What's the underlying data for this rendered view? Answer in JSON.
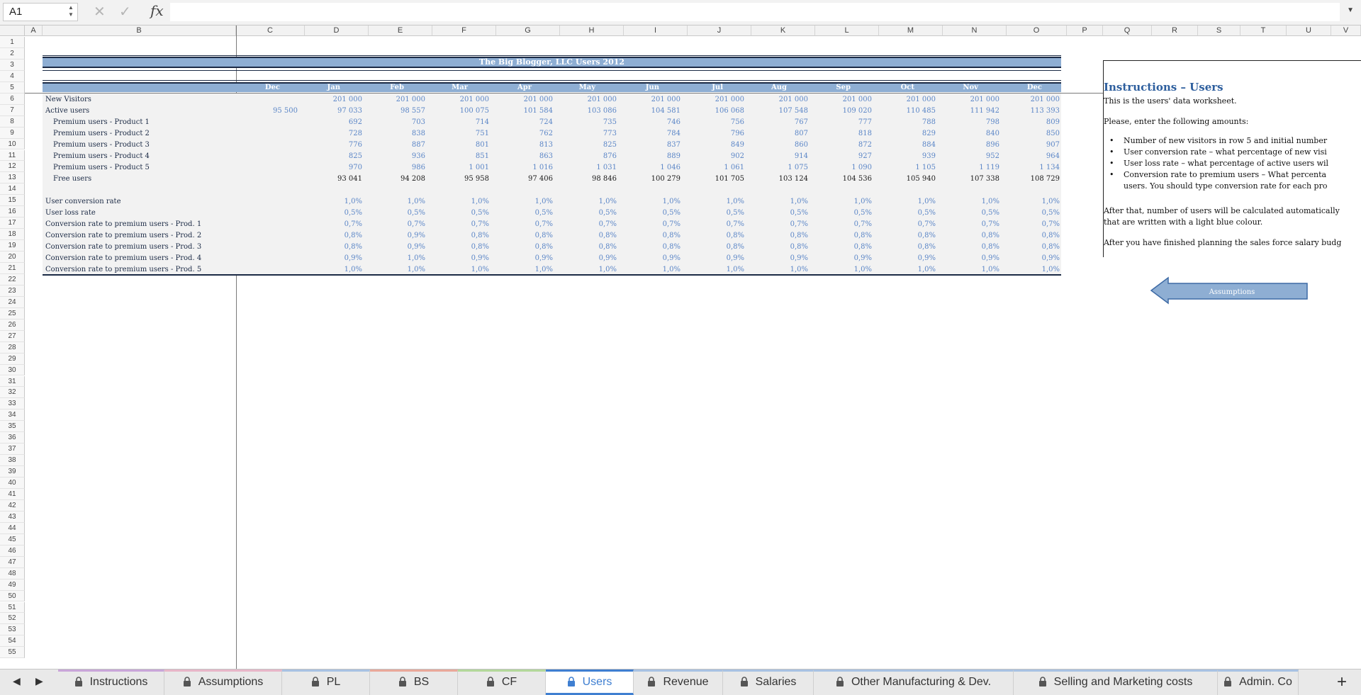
{
  "formula_bar": {
    "cell_ref": "A1",
    "formula": "",
    "fx_label": "fx"
  },
  "columns": [
    "A",
    "B",
    "C",
    "D",
    "E",
    "F",
    "G",
    "H",
    "I",
    "J",
    "K",
    "L",
    "M",
    "N",
    "O",
    "P",
    "Q",
    "R",
    "S",
    "T",
    "U",
    "V"
  ],
  "rows": [
    "1",
    "2",
    "3",
    "4",
    "5",
    "6",
    "7",
    "8",
    "9",
    "10",
    "11",
    "12",
    "13",
    "14",
    "15",
    "16",
    "17",
    "18",
    "19",
    "20",
    "21",
    "22",
    "23",
    "24",
    "25",
    "26",
    "27",
    "28",
    "29",
    "30",
    "31",
    "32",
    "33",
    "34",
    "35",
    "36",
    "37",
    "38",
    "39",
    "40",
    "41",
    "42",
    "43",
    "44",
    "45",
    "46",
    "47",
    "48",
    "49",
    "50",
    "51",
    "52",
    "53",
    "54",
    "55"
  ],
  "sheet": {
    "title": "The Big Blogger, LLC Users 2012",
    "months": [
      "Dec",
      "Jan",
      "Feb",
      "Mar",
      "Apr",
      "May",
      "Jun",
      "Jul",
      "Aug",
      "Sep",
      "Oct",
      "Nov",
      "Dec"
    ],
    "table": [
      {
        "label": "New Visitors",
        "indent": false,
        "values": [
          "",
          "201 000",
          "201 000",
          "201 000",
          "201 000",
          "201 000",
          "201 000",
          "201 000",
          "201 000",
          "201 000",
          "201 000",
          "201 000",
          "201 000"
        ],
        "style": "input"
      },
      {
        "label": "Active users",
        "indent": false,
        "values": [
          "95 500",
          "97 033",
          "98 557",
          "100 075",
          "101 584",
          "103 086",
          "104 581",
          "106 068",
          "107 548",
          "109 020",
          "110 485",
          "111 942",
          "113 393"
        ],
        "style": "input"
      },
      {
        "label": "Premium users - Product 1",
        "indent": true,
        "values": [
          "",
          "692",
          "703",
          "714",
          "724",
          "735",
          "746",
          "756",
          "767",
          "777",
          "788",
          "798",
          "809"
        ],
        "style": "input"
      },
      {
        "label": "Premium users - Product 2",
        "indent": true,
        "values": [
          "",
          "728",
          "838",
          "751",
          "762",
          "773",
          "784",
          "796",
          "807",
          "818",
          "829",
          "840",
          "850"
        ],
        "style": "input"
      },
      {
        "label": "Premium users - Product 3",
        "indent": true,
        "values": [
          "",
          "776",
          "887",
          "801",
          "813",
          "825",
          "837",
          "849",
          "860",
          "872",
          "884",
          "896",
          "907"
        ],
        "style": "input"
      },
      {
        "label": "Premium users - Product 4",
        "indent": true,
        "values": [
          "",
          "825",
          "936",
          "851",
          "863",
          "876",
          "889",
          "902",
          "914",
          "927",
          "939",
          "952",
          "964"
        ],
        "style": "input"
      },
      {
        "label": "Premium users - Product 5",
        "indent": true,
        "values": [
          "",
          "970",
          "986",
          "1 001",
          "1 016",
          "1 031",
          "1 046",
          "1 061",
          "1 075",
          "1 090",
          "1 105",
          "1 119",
          "1 134"
        ],
        "style": "input"
      },
      {
        "label": "Free users",
        "indent": true,
        "values": [
          "",
          "93 041",
          "94 208",
          "95 958",
          "97 406",
          "98 846",
          "100 279",
          "101 705",
          "103 124",
          "104 536",
          "105 940",
          "107 338",
          "108 729"
        ],
        "style": "calc"
      },
      {
        "label": "",
        "indent": false,
        "values": [
          "",
          "",
          "",
          "",
          "",
          "",
          "",
          "",
          "",
          "",
          "",
          "",
          ""
        ],
        "style": "input"
      },
      {
        "label": "User conversion rate",
        "indent": false,
        "values": [
          "",
          "1,0%",
          "1,0%",
          "1,0%",
          "1,0%",
          "1,0%",
          "1,0%",
          "1,0%",
          "1,0%",
          "1,0%",
          "1,0%",
          "1,0%",
          "1,0%"
        ],
        "style": "input"
      },
      {
        "label": "User loss rate",
        "indent": false,
        "values": [
          "",
          "0,5%",
          "0,5%",
          "0,5%",
          "0,5%",
          "0,5%",
          "0,5%",
          "0,5%",
          "0,5%",
          "0,5%",
          "0,5%",
          "0,5%",
          "0,5%"
        ],
        "style": "input"
      },
      {
        "label": "Conversion rate to premium users - Prod. 1",
        "indent": false,
        "values": [
          "",
          "0,7%",
          "0,7%",
          "0,7%",
          "0,7%",
          "0,7%",
          "0,7%",
          "0,7%",
          "0,7%",
          "0,7%",
          "0,7%",
          "0,7%",
          "0,7%"
        ],
        "style": "input"
      },
      {
        "label": "Conversion rate to premium users - Prod. 2",
        "indent": false,
        "values": [
          "",
          "0,8%",
          "0,9%",
          "0,8%",
          "0,8%",
          "0,8%",
          "0,8%",
          "0,8%",
          "0,8%",
          "0,8%",
          "0,8%",
          "0,8%",
          "0,8%"
        ],
        "style": "input"
      },
      {
        "label": "Conversion rate to premium users - Prod. 3",
        "indent": false,
        "values": [
          "",
          "0,8%",
          "0,9%",
          "0,8%",
          "0,8%",
          "0,8%",
          "0,8%",
          "0,8%",
          "0,8%",
          "0,8%",
          "0,8%",
          "0,8%",
          "0,8%"
        ],
        "style": "input"
      },
      {
        "label": "Conversion rate to premium users - Prod. 4",
        "indent": false,
        "values": [
          "",
          "0,9%",
          "1,0%",
          "0,9%",
          "0,9%",
          "0,9%",
          "0,9%",
          "0,9%",
          "0,9%",
          "0,9%",
          "0,9%",
          "0,9%",
          "0,9%"
        ],
        "style": "input"
      },
      {
        "label": "Conversion rate to premium users - Prod. 5",
        "indent": false,
        "values": [
          "",
          "1,0%",
          "1,0%",
          "1,0%",
          "1,0%",
          "1,0%",
          "1,0%",
          "1,0%",
          "1,0%",
          "1,0%",
          "1,0%",
          "1,0%",
          "1,0%"
        ],
        "style": "input"
      }
    ]
  },
  "instructions": {
    "heading": "Instructions – Users",
    "intro": "This is the users' data worksheet.",
    "please": "Please, enter the following amounts:",
    "bullets": [
      "Number of new visitors in row 5 and initial number",
      "User conversion rate – what percentage of new visi",
      "User loss rate – what percentage of active users wil",
      "Conversion rate to premium users – What percenta",
      "users. You should type conversion rate for each pro"
    ],
    "after1": "After that, number of users will be calculated automatically",
    "after2": "that are written with a light blue colour.",
    "after3": "After you have finished planning the sales force salary budg"
  },
  "nav_button": {
    "label": "Assumptions"
  },
  "tabs": [
    {
      "label": "Instructions",
      "locked": true,
      "active": false,
      "accent": "#c9a6d9"
    },
    {
      "label": "Assumptions",
      "locked": true,
      "active": false,
      "accent": "#e7b6c8"
    },
    {
      "label": "PL",
      "locked": true,
      "active": false,
      "accent": "#a8c2e3"
    },
    {
      "label": "BS",
      "locked": true,
      "active": false,
      "accent": "#e9a89a"
    },
    {
      "label": "CF",
      "locked": true,
      "active": false,
      "accent": "#b3d89b"
    },
    {
      "label": "Users",
      "locked": true,
      "active": true,
      "accent": "#3f7fd1"
    },
    {
      "label": "Revenue",
      "locked": true,
      "active": false,
      "accent": "#a8c2e3"
    },
    {
      "label": "Salaries",
      "locked": true,
      "active": false,
      "accent": "#a8c2e3"
    },
    {
      "label": "Other Manufacturing & Dev.",
      "locked": true,
      "active": false,
      "accent": "#a8c2e3"
    },
    {
      "label": "Selling and Marketing costs",
      "locked": true,
      "active": false,
      "accent": "#a8c2e3"
    },
    {
      "label": "Admin. Co",
      "locked": true,
      "active": false,
      "accent": "#a8c2e3"
    }
  ],
  "icons": {
    "prev": "triangle-left-icon",
    "next": "triangle-right-icon",
    "add": "plus-icon",
    "lock": "lock-icon"
  }
}
